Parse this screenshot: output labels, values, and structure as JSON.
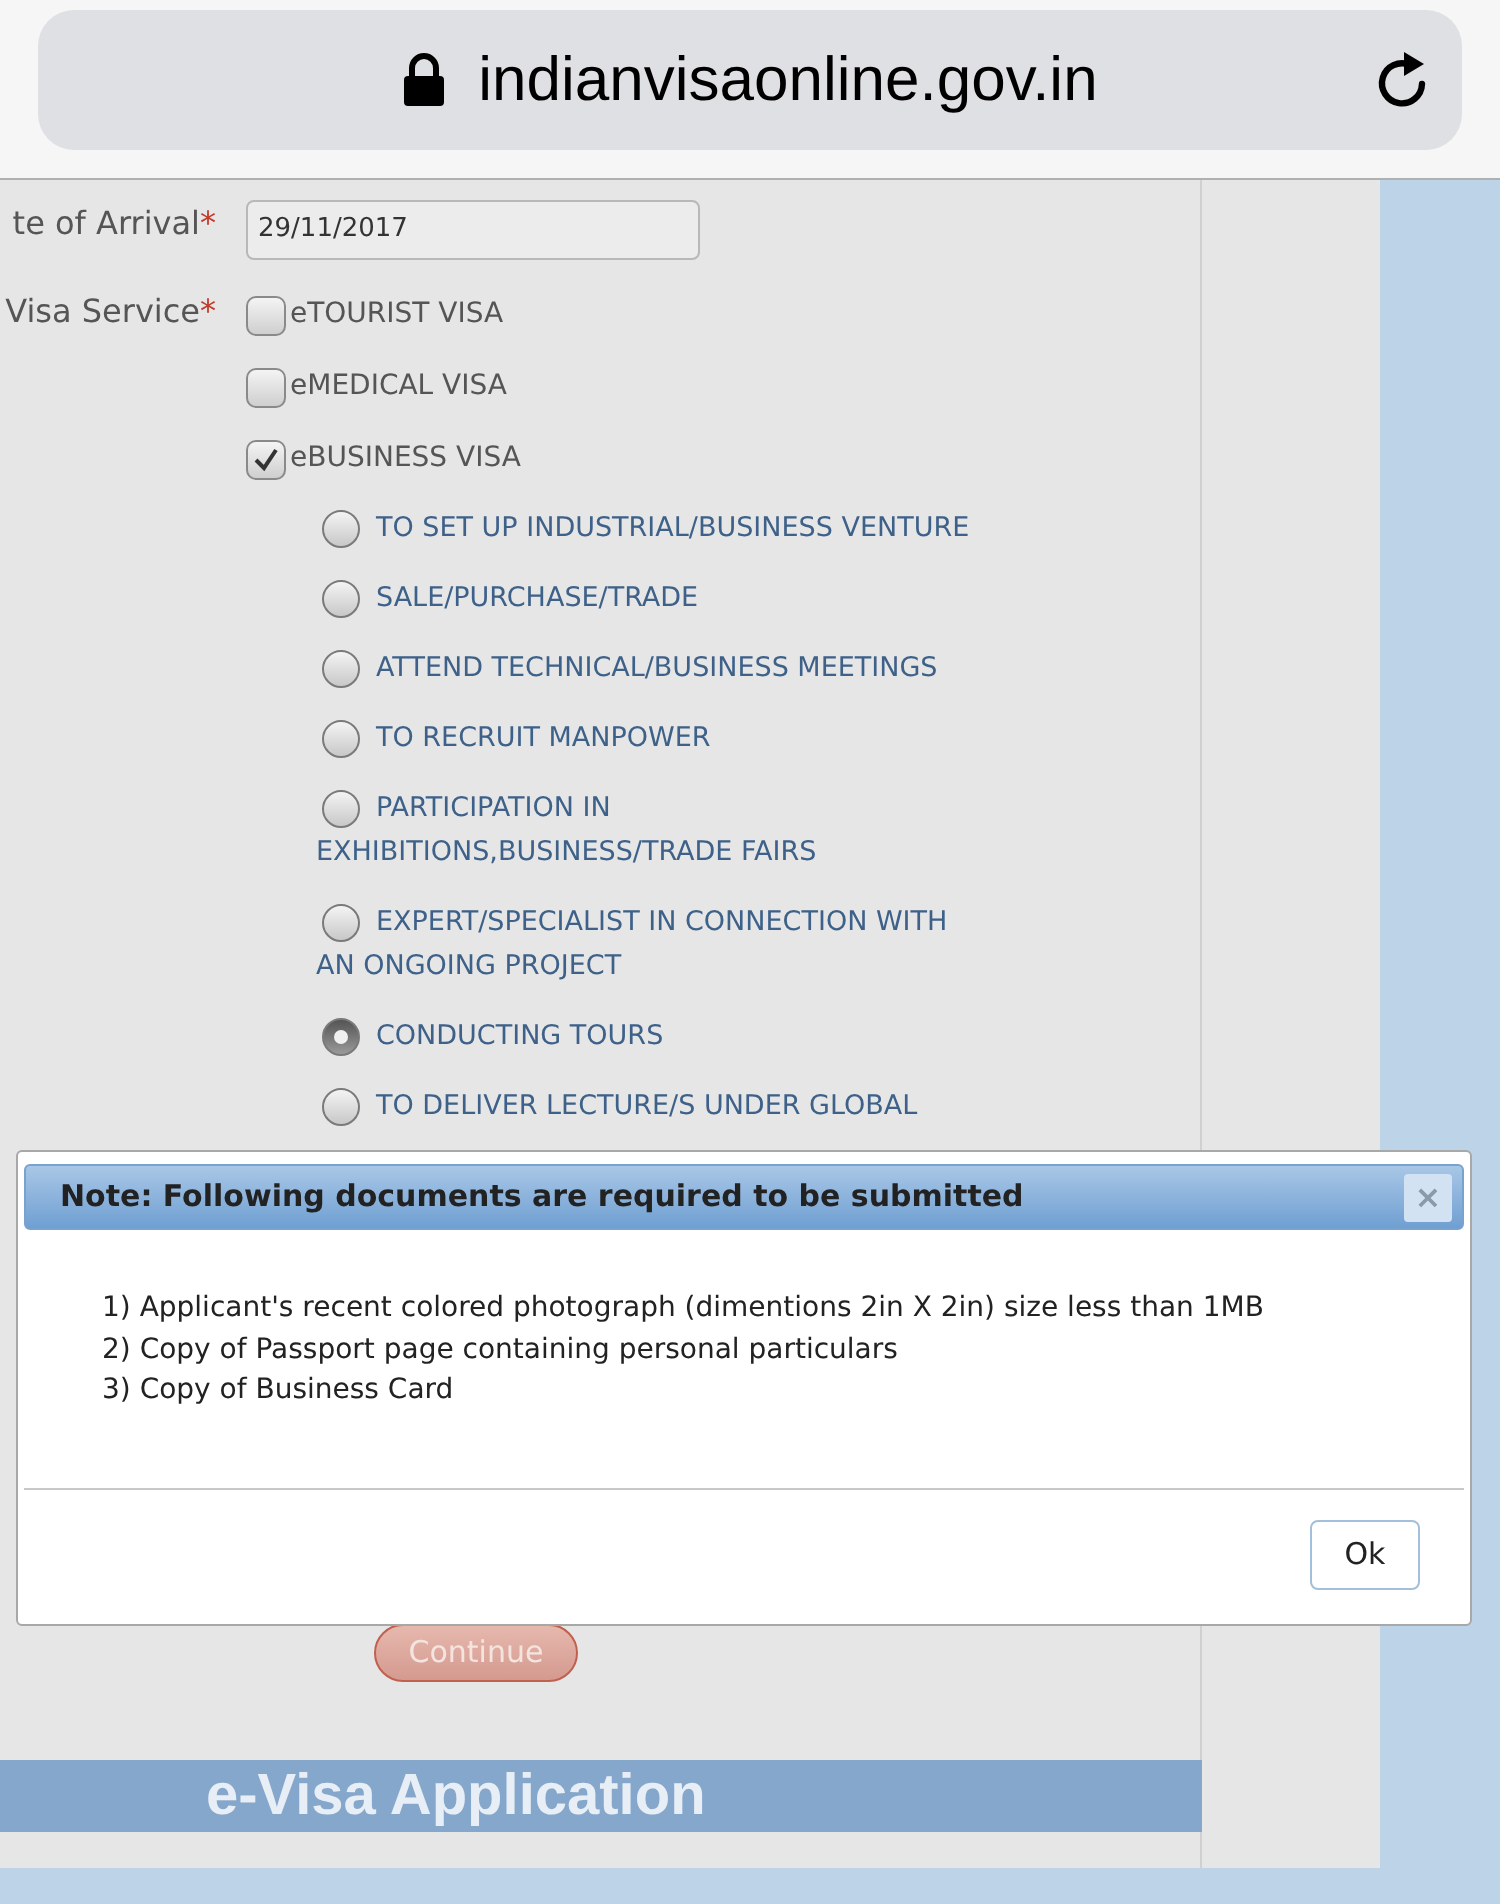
{
  "address_bar": {
    "url": "indianvisaonline.gov.in"
  },
  "form": {
    "arrival": {
      "label": "te of Arrival",
      "required": "*",
      "value": "29/11/2017"
    },
    "visa_service": {
      "label": "Visa Service",
      "required": "*",
      "options": [
        {
          "label": "eTOURIST VISA",
          "checked": false
        },
        {
          "label": "eMEDICAL VISA",
          "checked": false
        },
        {
          "label": "eBUSINESS VISA",
          "checked": true
        }
      ]
    },
    "purposes": [
      {
        "lines": [
          "TO SET UP INDUSTRIAL/BUSINESS VENTURE"
        ],
        "selected": false
      },
      {
        "lines": [
          "SALE/PURCHASE/TRADE"
        ],
        "selected": false
      },
      {
        "lines": [
          "ATTEND TECHNICAL/BUSINESS MEETINGS"
        ],
        "selected": false
      },
      {
        "lines": [
          "TO RECRUIT MANPOWER"
        ],
        "selected": false
      },
      {
        "lines": [
          "PARTICIPATION IN",
          "EXHIBITIONS,BUSINESS/TRADE FAIRS"
        ],
        "selected": false
      },
      {
        "lines": [
          "EXPERT/SPECIALIST IN CONNECTION WITH",
          "AN ONGOING PROJECT"
        ],
        "selected": false
      },
      {
        "lines": [
          "CONDUCTING TOURS"
        ],
        "selected": true
      },
      {
        "lines": [
          "TO DELIVER LECTURE/S UNDER GLOBAL"
        ],
        "selected": false
      }
    ],
    "continue_button": "Continue"
  },
  "banner": "e-Visa Application",
  "dialog": {
    "title": "Note: Following documents are required to be submitted",
    "close": "×",
    "items": [
      "1) Applicant's recent colored photograph (dimentions 2in X 2in) size less than 1MB",
      "2) Copy of Passport page containing personal particulars",
      "3) Copy of Business Card"
    ],
    "ok_button": "Ok"
  }
}
